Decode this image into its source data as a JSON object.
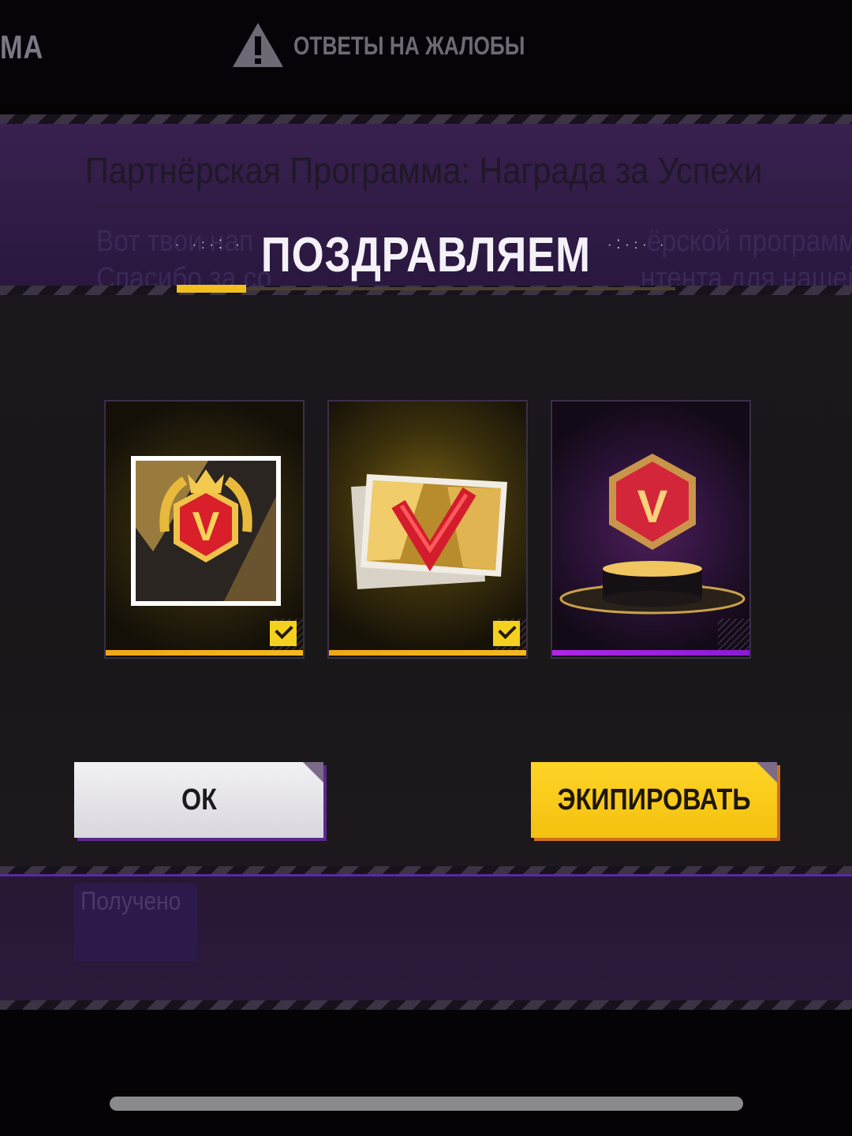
{
  "topbar": {
    "left_tab_partial": "МА",
    "warning_icon": "warning-triangle-icon",
    "complaints_tab": "ОТВЕТЫ НА ЖАЛОБЫ"
  },
  "background_panel": {
    "title": "Партнёрская Программа: Награда за Успехи",
    "line1_left": "Вот твои нап",
    "line1_right": "ёрской программе",
    "line2_left": "Спасибо за со",
    "line2_right": "нтента для нашей",
    "received_label": "Получено"
  },
  "modal": {
    "heading": "ПОЗДРАВЛЯЕМ",
    "heading_progress": 0.14,
    "rewards": [
      {
        "icon": "v-badge-avatar-icon",
        "claimed": true,
        "rarity_color": "#f3b41d"
      },
      {
        "icon": "v-banner-card-icon",
        "claimed": true,
        "rarity_color": "#f3b41d"
      },
      {
        "icon": "v-emblem-pedestal-icon",
        "claimed": false,
        "rarity_color": "#b026e6"
      }
    ],
    "ok_label": "ОК",
    "equip_label": "ЭКИПИРОВАТЬ"
  },
  "colors": {
    "accent_yellow": "#f3c10f",
    "accent_purple": "#8a1bd0",
    "modal_bg": "#1b171d"
  }
}
